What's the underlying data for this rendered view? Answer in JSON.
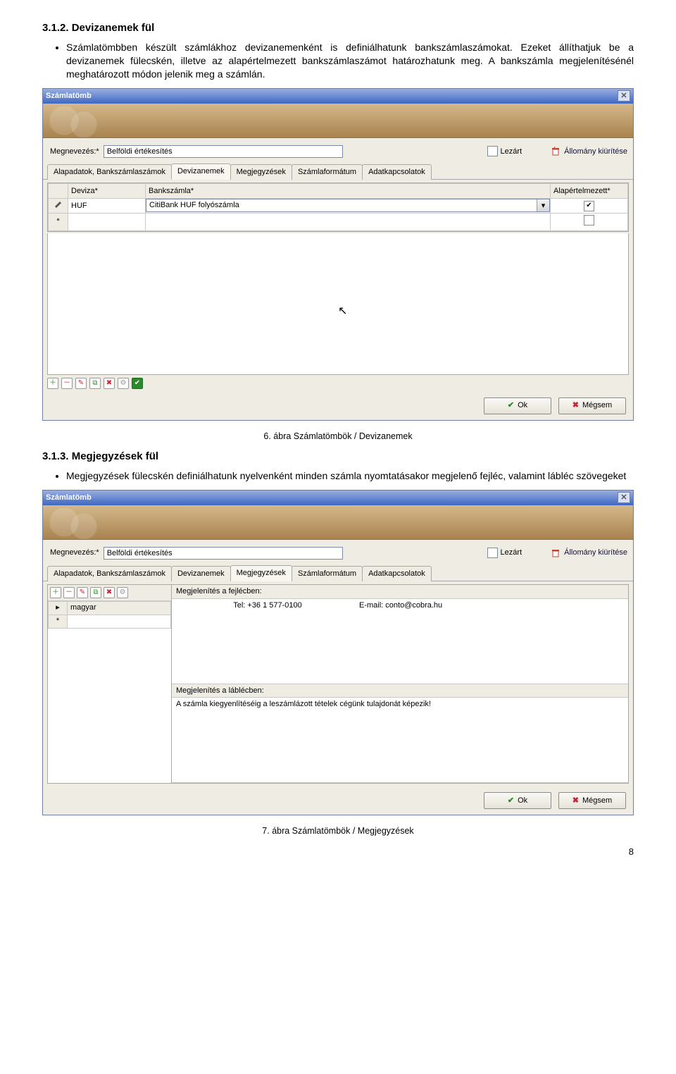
{
  "doc": {
    "h312": "3.1.2. Devizanemek fül",
    "p312": "Számlatömbben készült számlákhoz devizanemenként is definiálhatunk bankszámlaszámokat. Ezeket állíthatjuk be a devizanemek fülecskén, illetve az alapértelmezett bankszámlaszámot határozhatunk meg. A bankszámla megjelenítésénél meghatározott módon jelenik meg a számlán.",
    "figcap1": "6. ábra Számlatömbök / Devizanemek",
    "h313": "3.1.3. Megjegyzések fül",
    "p313": "Megjegyzések fülecskén definiálhatunk nyelvenként minden számla nyomtatásakor megjelenő fejléc, valamint lábléc szövegeket",
    "figcap2": "7. ábra Számlatömbök / Megjegyzések",
    "pagenum": "8"
  },
  "common": {
    "window_title": "Számlatömb",
    "megnevezes_label": "Megnevezés:*",
    "megnevezes_value": "Belföldi értékesítés",
    "lezart_label": "Lezárt",
    "allomany_label": "Állomány kiürítése",
    "ok": "Ok",
    "megsem": "Mégsem",
    "tabs": {
      "t1": "Alapadatok, Bankszámlaszámok",
      "t2": "Devizanemek",
      "t3": "Megjegyzések",
      "t4": "Számlaformátum",
      "t5": "Adatkapcsolatok"
    }
  },
  "shot1": {
    "col_deviza": "Deviza*",
    "col_bankszamla": "Bankszámla*",
    "col_alap": "Alapértelmezett*",
    "row1_deviza": "HUF",
    "row1_bank": "CitiBank HUF folyószámla",
    "row1_check": "✔"
  },
  "shot2": {
    "lang_row": "magyar",
    "lbl_fejlec": "Megjelenítés a fejlécben:",
    "fej_tel": "Tel: +36 1 577-0100",
    "fej_email": "E-mail: conto@cobra.hu",
    "lbl_lablec": "Megjelenítés a láblécben:",
    "lablec_text": "A számla kiegyenlítéséig a leszámlázott tételek cégünk tulajdonát képezik!"
  }
}
